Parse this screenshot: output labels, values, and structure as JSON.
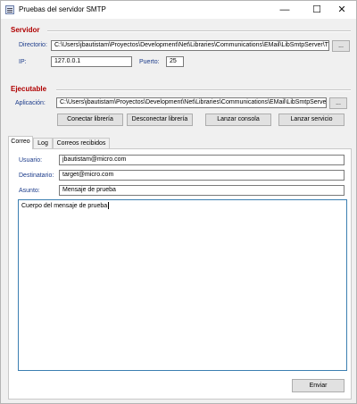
{
  "window": {
    "title": "Pruebas del servidor SMTP",
    "controls": {
      "minimize": "—",
      "maximize": "☐",
      "close": "✕"
    }
  },
  "servidor": {
    "heading": "Servidor",
    "directorio_label": "Directorio:",
    "directorio_value": "C:\\Users\\jbautistam\\Proyectos\\Development\\Net\\Libraries\\Communications\\EMail\\LibSmtpServer\\T",
    "browse_label": "...",
    "ip_label": "IP:",
    "ip_value": "127.0.0.1",
    "puerto_label": "Puerto:",
    "puerto_value": "25"
  },
  "ejecutable": {
    "heading": "Ejecutable",
    "aplicacion_label": "Aplicación:",
    "aplicacion_value": "C:\\Users\\jbautistam\\Proyectos\\Development\\Net\\Libraries\\Communications\\EMail\\LibSmtpServer",
    "browse_label": "...",
    "buttons": {
      "conectar": "Conectar librería",
      "desconectar": "Desconectar librería",
      "consola": "Lanzar consola",
      "servicio": "Lanzar servicio"
    }
  },
  "tabs": [
    "Correo",
    "Log",
    "Correos recibidos"
  ],
  "active_tab": "Correo",
  "correo": {
    "usuario_label": "Usuario:",
    "usuario_value": "jbautistam@micro.com",
    "destinatario_label": "Destinatario:",
    "destinatario_value": "target@micro.com",
    "asunto_label": "Asunto:",
    "asunto_value": "Mensaje de prueba",
    "cuerpo_value": "Cuerpo del mensaje de prueba",
    "enviar_label": "Enviar"
  },
  "colors": {
    "section_heading": "#b00000",
    "field_label": "#1a3a8a",
    "focus_border": "#3c7fb1"
  }
}
